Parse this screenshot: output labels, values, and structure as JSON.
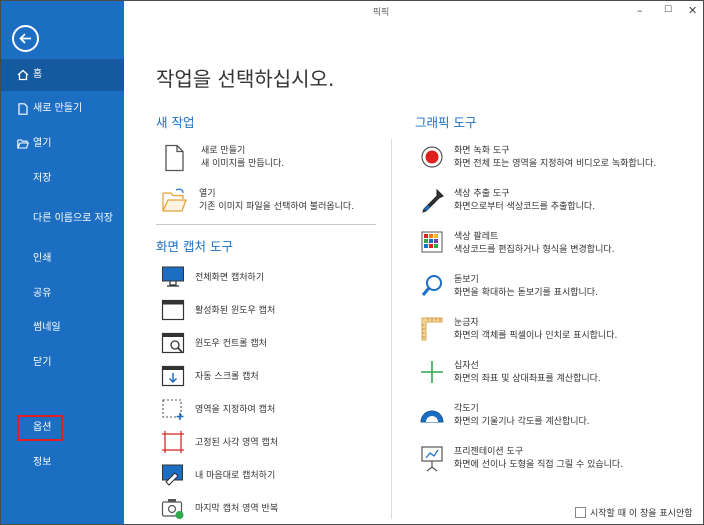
{
  "window": {
    "title": "픽픽",
    "minimize": "–",
    "maximize": "☐",
    "close": "✕"
  },
  "sidebar": {
    "items": [
      {
        "label": "홈"
      },
      {
        "label": "새로 만들기"
      },
      {
        "label": "열기"
      },
      {
        "label": "저장"
      },
      {
        "label": "다른 이름으로 저장"
      },
      {
        "label": "인쇄"
      },
      {
        "label": "공유"
      },
      {
        "label": "썸네일"
      },
      {
        "label": "닫기"
      },
      {
        "label": "옵션"
      },
      {
        "label": "정보"
      }
    ]
  },
  "main": {
    "heading": "작업을 선택하십시오.",
    "new_task": {
      "title": "새 작업",
      "items": [
        {
          "title": "새로 만들기",
          "desc": "새 이미지를 만듭니다."
        },
        {
          "title": "열기",
          "desc": "기존 이미지 파일을 선택하여 불러옵니다."
        }
      ]
    },
    "capture": {
      "title": "화면 캡처 도구",
      "items": [
        {
          "label": "전체화면 캡처하기"
        },
        {
          "label": "활성화된 윈도우 캡처"
        },
        {
          "label": "윈도우 컨트롤 캡처"
        },
        {
          "label": "자동 스크롤 캡처"
        },
        {
          "label": "영역을 지정하여 캡처"
        },
        {
          "label": "고정된 사각 영역 캡처"
        },
        {
          "label": "내 마음대로 캡처하기"
        },
        {
          "label": "마지막 캡처 영역 반복"
        }
      ]
    },
    "graphic": {
      "title": "그래픽 도구",
      "items": [
        {
          "title": "화면 녹화 도구",
          "desc": "화면 전체 또는 영역을 지정하여 비디오로 녹화합니다."
        },
        {
          "title": "색상 추출 도구",
          "desc": "화면으로부터 색상코드를 추출합니다."
        },
        {
          "title": "색상 팔레트",
          "desc": "색상코드를 편집하거나 형식을 변경합니다."
        },
        {
          "title": "돋보기",
          "desc": "화면을 확대하는 돋보기를 표시합니다."
        },
        {
          "title": "눈금자",
          "desc": "화면의 객체를 픽셀이나 인치로 표시합니다."
        },
        {
          "title": "십자선",
          "desc": "화면의 좌표 및 상대좌표를 계산합니다."
        },
        {
          "title": "각도기",
          "desc": "화면의 기울기나 각도를 계산합니다."
        },
        {
          "title": "프리젠테이션 도구",
          "desc": "화면에 선이나 도형을 직접 그릴 수 있습니다."
        }
      ]
    },
    "startup_checkbox": "시작할 때 이 창을 표시안함"
  },
  "colors": {
    "sidebar": "#1b6ec2",
    "accent": "#1b6ec2",
    "highlight_box": "#e02020"
  }
}
